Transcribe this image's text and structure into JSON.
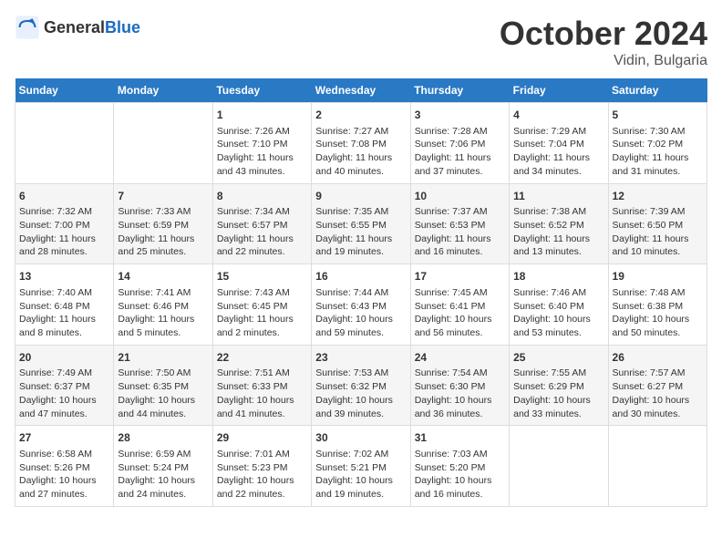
{
  "header": {
    "logo_general": "General",
    "logo_blue": "Blue",
    "month_year": "October 2024",
    "location": "Vidin, Bulgaria"
  },
  "calendar": {
    "days_of_week": [
      "Sunday",
      "Monday",
      "Tuesday",
      "Wednesday",
      "Thursday",
      "Friday",
      "Saturday"
    ],
    "weeks": [
      [
        {
          "day": "",
          "content": ""
        },
        {
          "day": "",
          "content": ""
        },
        {
          "day": "1",
          "content": "Sunrise: 7:26 AM\nSunset: 7:10 PM\nDaylight: 11 hours and 43 minutes."
        },
        {
          "day": "2",
          "content": "Sunrise: 7:27 AM\nSunset: 7:08 PM\nDaylight: 11 hours and 40 minutes."
        },
        {
          "day": "3",
          "content": "Sunrise: 7:28 AM\nSunset: 7:06 PM\nDaylight: 11 hours and 37 minutes."
        },
        {
          "day": "4",
          "content": "Sunrise: 7:29 AM\nSunset: 7:04 PM\nDaylight: 11 hours and 34 minutes."
        },
        {
          "day": "5",
          "content": "Sunrise: 7:30 AM\nSunset: 7:02 PM\nDaylight: 11 hours and 31 minutes."
        }
      ],
      [
        {
          "day": "6",
          "content": "Sunrise: 7:32 AM\nSunset: 7:00 PM\nDaylight: 11 hours and 28 minutes."
        },
        {
          "day": "7",
          "content": "Sunrise: 7:33 AM\nSunset: 6:59 PM\nDaylight: 11 hours and 25 minutes."
        },
        {
          "day": "8",
          "content": "Sunrise: 7:34 AM\nSunset: 6:57 PM\nDaylight: 11 hours and 22 minutes."
        },
        {
          "day": "9",
          "content": "Sunrise: 7:35 AM\nSunset: 6:55 PM\nDaylight: 11 hours and 19 minutes."
        },
        {
          "day": "10",
          "content": "Sunrise: 7:37 AM\nSunset: 6:53 PM\nDaylight: 11 hours and 16 minutes."
        },
        {
          "day": "11",
          "content": "Sunrise: 7:38 AM\nSunset: 6:52 PM\nDaylight: 11 hours and 13 minutes."
        },
        {
          "day": "12",
          "content": "Sunrise: 7:39 AM\nSunset: 6:50 PM\nDaylight: 11 hours and 10 minutes."
        }
      ],
      [
        {
          "day": "13",
          "content": "Sunrise: 7:40 AM\nSunset: 6:48 PM\nDaylight: 11 hours and 8 minutes."
        },
        {
          "day": "14",
          "content": "Sunrise: 7:41 AM\nSunset: 6:46 PM\nDaylight: 11 hours and 5 minutes."
        },
        {
          "day": "15",
          "content": "Sunrise: 7:43 AM\nSunset: 6:45 PM\nDaylight: 11 hours and 2 minutes."
        },
        {
          "day": "16",
          "content": "Sunrise: 7:44 AM\nSunset: 6:43 PM\nDaylight: 10 hours and 59 minutes."
        },
        {
          "day": "17",
          "content": "Sunrise: 7:45 AM\nSunset: 6:41 PM\nDaylight: 10 hours and 56 minutes."
        },
        {
          "day": "18",
          "content": "Sunrise: 7:46 AM\nSunset: 6:40 PM\nDaylight: 10 hours and 53 minutes."
        },
        {
          "day": "19",
          "content": "Sunrise: 7:48 AM\nSunset: 6:38 PM\nDaylight: 10 hours and 50 minutes."
        }
      ],
      [
        {
          "day": "20",
          "content": "Sunrise: 7:49 AM\nSunset: 6:37 PM\nDaylight: 10 hours and 47 minutes."
        },
        {
          "day": "21",
          "content": "Sunrise: 7:50 AM\nSunset: 6:35 PM\nDaylight: 10 hours and 44 minutes."
        },
        {
          "day": "22",
          "content": "Sunrise: 7:51 AM\nSunset: 6:33 PM\nDaylight: 10 hours and 41 minutes."
        },
        {
          "day": "23",
          "content": "Sunrise: 7:53 AM\nSunset: 6:32 PM\nDaylight: 10 hours and 39 minutes."
        },
        {
          "day": "24",
          "content": "Sunrise: 7:54 AM\nSunset: 6:30 PM\nDaylight: 10 hours and 36 minutes."
        },
        {
          "day": "25",
          "content": "Sunrise: 7:55 AM\nSunset: 6:29 PM\nDaylight: 10 hours and 33 minutes."
        },
        {
          "day": "26",
          "content": "Sunrise: 7:57 AM\nSunset: 6:27 PM\nDaylight: 10 hours and 30 minutes."
        }
      ],
      [
        {
          "day": "27",
          "content": "Sunrise: 6:58 AM\nSunset: 5:26 PM\nDaylight: 10 hours and 27 minutes."
        },
        {
          "day": "28",
          "content": "Sunrise: 6:59 AM\nSunset: 5:24 PM\nDaylight: 10 hours and 24 minutes."
        },
        {
          "day": "29",
          "content": "Sunrise: 7:01 AM\nSunset: 5:23 PM\nDaylight: 10 hours and 22 minutes."
        },
        {
          "day": "30",
          "content": "Sunrise: 7:02 AM\nSunset: 5:21 PM\nDaylight: 10 hours and 19 minutes."
        },
        {
          "day": "31",
          "content": "Sunrise: 7:03 AM\nSunset: 5:20 PM\nDaylight: 10 hours and 16 minutes."
        },
        {
          "day": "",
          "content": ""
        },
        {
          "day": "",
          "content": ""
        }
      ]
    ]
  }
}
